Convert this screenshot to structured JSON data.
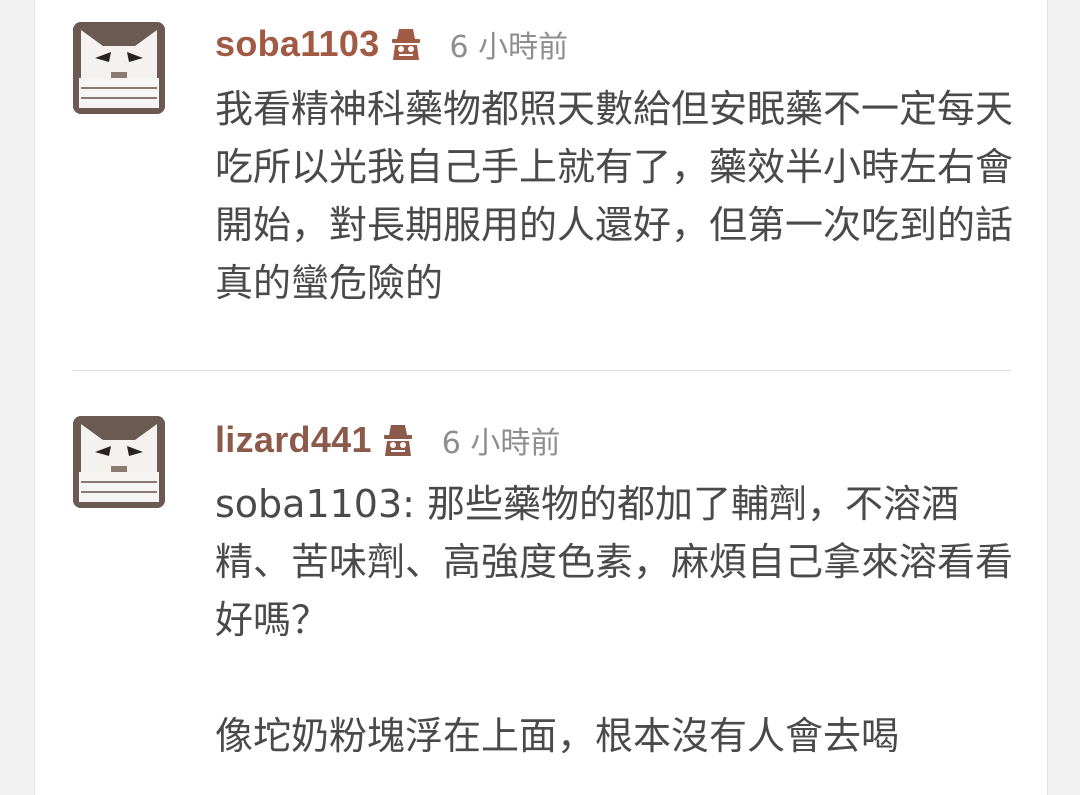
{
  "comments": [
    {
      "username": "soba1103",
      "user_icon": "spy-hat-icon",
      "time": "6 小時前",
      "text": "我看精神科藥物都照天數給但安眠藥不一定每天吃所以光我自己手上就有了，藥效半小時左右會開始，對長期服用的人還好，但第一次吃到的話真的蠻危險的"
    },
    {
      "username": "lizard441",
      "user_icon": "spy-hat-icon",
      "time": "6 小時前",
      "text": "soba1103: 那些藥物的都加了輔劑，不溶酒精、苦味劑、高強度色素，麻煩自己拿來溶看看好嗎？\n\n像坨奶粉塊浮在上面，根本沒有人會去喝"
    }
  ],
  "colors": {
    "username_1": "#a15a44",
    "username_2": "#8c5a4a",
    "timestamp": "#8e8e8e",
    "body_text": "#4a4a4a",
    "avatar_bg": "#6b5a52"
  }
}
